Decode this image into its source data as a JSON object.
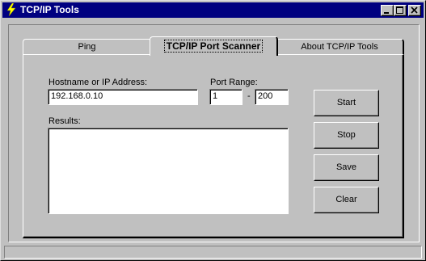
{
  "window": {
    "title": "TCP/IP Tools",
    "icon": "lightning-bolt-icon"
  },
  "tabs": [
    {
      "label": "Ping",
      "selected": false
    },
    {
      "label": "TCP/IP Port Scanner",
      "selected": true
    },
    {
      "label": "About TCP/IP Tools",
      "selected": false
    }
  ],
  "form": {
    "hostname_label": "Hostname or IP Address:",
    "hostname_value": "192.168.0.10",
    "port_range_label": "Port Range:",
    "port_from": "1",
    "port_separator": "-",
    "port_to": "200",
    "results_label": "Results:",
    "results_value": ""
  },
  "buttons": {
    "start": "Start",
    "stop": "Stop",
    "save": "Save",
    "clear": "Clear"
  },
  "status": {
    "text": ""
  },
  "colors": {
    "titlebar": "#000080",
    "face": "#c0c0c0"
  }
}
